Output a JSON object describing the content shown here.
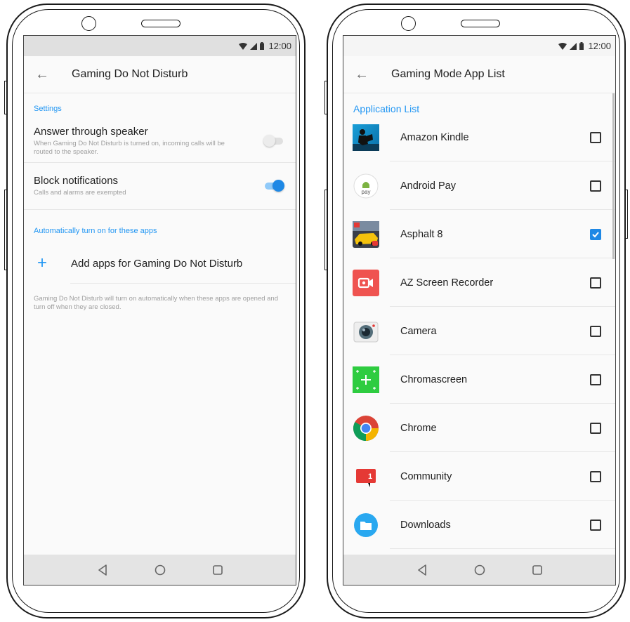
{
  "colors": {
    "accent": "#2196f3",
    "toggle_on": "#1e88e5",
    "navbar": "#e4e4e4",
    "screen_bg": "#fafafa"
  },
  "left_screen": {
    "status": {
      "time": "12:00",
      "icons": [
        "wifi-icon",
        "signal-icon",
        "battery-icon"
      ]
    },
    "appbar": {
      "back_icon": "arrow-back-icon",
      "title": "Gaming Do Not Disturb"
    },
    "settings_header": "Settings",
    "settings": [
      {
        "title": "Answer through speaker",
        "subtitle": "When Gaming Do Not Disturb is turned on, incoming calls will be routed to the speaker.",
        "enabled": false
      },
      {
        "title": "Block notifications",
        "subtitle": "Calls and alarms are exempted",
        "enabled": true
      }
    ],
    "auto_header": "Automatically turn on for these apps",
    "add_apps": {
      "icon": "plus-icon",
      "label": "Add apps for Gaming Do Not Disturb"
    },
    "footnote": "Gaming Do Not Disturb will turn on automatically when these apps are opened and turn off when they are closed.",
    "navbar": [
      "back-triangle-icon",
      "home-circle-icon",
      "recents-square-icon"
    ]
  },
  "right_screen": {
    "status": {
      "time": "12:00",
      "icons": [
        "wifi-icon",
        "signal-icon",
        "battery-icon"
      ]
    },
    "appbar": {
      "back_icon": "arrow-back-icon",
      "title": "Gaming Mode App List"
    },
    "list_header": "Application List",
    "apps": [
      {
        "name": "Amazon Kindle",
        "icon": "kindle-icon",
        "checked": false
      },
      {
        "name": "Android Pay",
        "icon": "android-pay-icon",
        "checked": false
      },
      {
        "name": "Asphalt 8",
        "icon": "asphalt-icon",
        "checked": true
      },
      {
        "name": "AZ Screen Recorder",
        "icon": "az-recorder-icon",
        "checked": false
      },
      {
        "name": "Camera",
        "icon": "camera-icon",
        "checked": false
      },
      {
        "name": "Chromascreen",
        "icon": "chromascreen-icon",
        "checked": false
      },
      {
        "name": "Chrome",
        "icon": "chrome-icon",
        "checked": false
      },
      {
        "name": "Community",
        "icon": "community-icon",
        "checked": false
      },
      {
        "name": "Downloads",
        "icon": "downloads-icon",
        "checked": false
      }
    ],
    "navbar": [
      "back-triangle-icon",
      "home-circle-icon",
      "recents-square-icon"
    ]
  }
}
